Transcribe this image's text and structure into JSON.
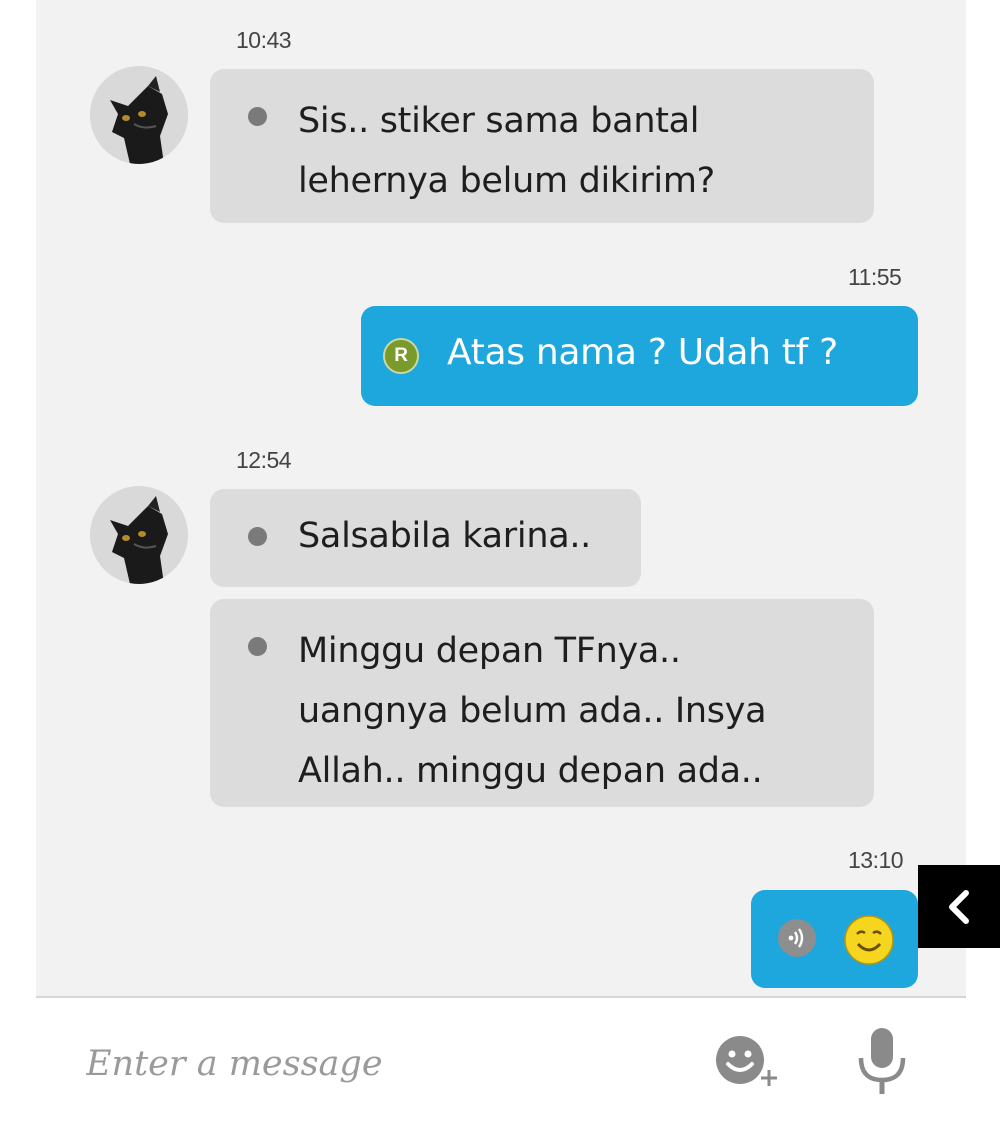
{
  "messages": [
    {
      "time": "10:43",
      "direction": "incoming",
      "lines": [
        "Sis.. stiker sama bantal",
        "lehernya belum dikirim?"
      ]
    },
    {
      "time": "11:55",
      "direction": "outgoing",
      "badge": "R",
      "text": "Atas nama ? Udah tf ?"
    },
    {
      "time": "12:54",
      "direction": "incoming",
      "lines": [
        "Salsabila karina.."
      ]
    },
    {
      "direction": "incoming",
      "lines": [
        "Minggu depan TFnya..",
        "uangnya belum ada.. Insya",
        "Allah.. minggu depan ada.."
      ]
    },
    {
      "time": "13:10",
      "direction": "outgoing",
      "icons": [
        "voice-note-icon",
        "smiling-face-emoji-icon"
      ]
    }
  ],
  "composer": {
    "placeholder": "Enter a message",
    "emoji_button_icon": "emoji-add-icon",
    "mic_button_icon": "microphone-icon"
  },
  "side_tab_icon": "chevron-left-icon",
  "colors": {
    "outgoing_bubble": "#1ea7dd",
    "incoming_bubble": "#dcdcdc",
    "chat_background": "#f2f2f2",
    "badge": "#7a9a2c"
  }
}
